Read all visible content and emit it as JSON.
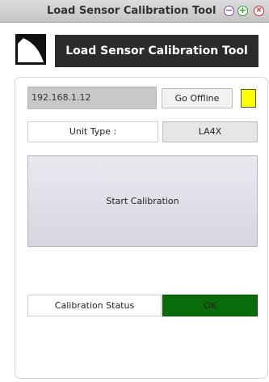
{
  "window": {
    "title": "Load Sensor Calibration Tool",
    "minimize_symbol": "−",
    "maximize_symbol": "+",
    "close_symbol": "×"
  },
  "header": {
    "title": "Load Sensor Calibration Tool",
    "logo_icon": "corner-curve-logo-icon"
  },
  "connection": {
    "ip_address": "192.168.1.12",
    "offline_button_label": "Go Offline",
    "indicator_color": "#ffff00"
  },
  "unit": {
    "label": "Unit Type :",
    "value": "LA4X"
  },
  "calibration": {
    "start_button_label": "Start Calibration",
    "status_label": "Calibration Status",
    "status_value": "OK",
    "status_color": "#0a6b0a"
  }
}
